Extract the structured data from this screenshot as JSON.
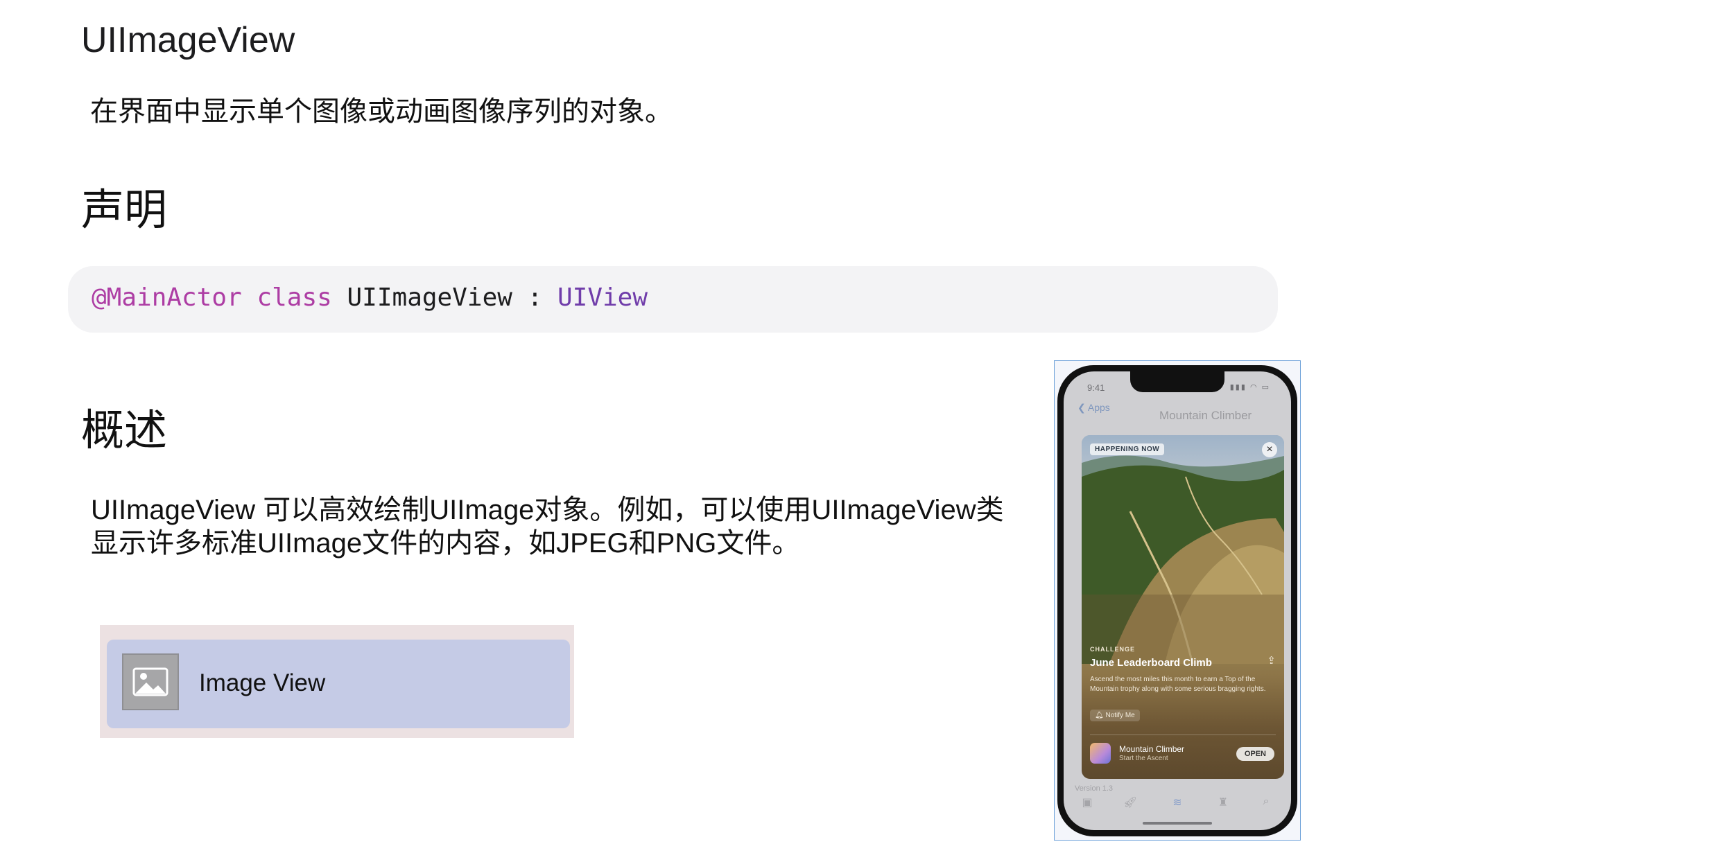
{
  "page": {
    "title": "UIImageView",
    "subtitle": "在界面中显示单个图像或动画图像序列的对象。",
    "declaration_heading": "声明",
    "code": {
      "attribute": "@MainActor",
      "keyword": "class",
      "name": "UIImageView",
      "separator": ":",
      "superclass": "UIView"
    },
    "overview_heading": "概述",
    "overview_text": "UIImageView 可以高效绘制UIImage对象。例如，可以使用UIImageView类显示许多标准UIImage文件的内容，如JPEG和PNG文件。"
  },
  "widget": {
    "label": "Image View",
    "icon": "photo-icon"
  },
  "phone": {
    "status_time": "9:41",
    "back_label": "Apps",
    "background_title": "Mountain Climber",
    "card": {
      "badge": "HAPPENING NOW",
      "close_icon": "close-icon",
      "category": "CHALLENGE",
      "title": "June Leaderboard Climb",
      "share_icon": "share-icon",
      "description": "Ascend the most miles this month to earn a Top of the Mountain trophy along with some serious bragging rights.",
      "notify_label": "Notify Me",
      "app_name": "Mountain Climber",
      "app_subtitle": "Start the Ascent",
      "open_label": "OPEN"
    },
    "version": "Version 1.3",
    "tabs": [
      "today-icon",
      "games-icon",
      "apps-icon",
      "arcade-icon",
      "search-icon"
    ]
  },
  "colors": {
    "code_keyword": "#ad3da4",
    "code_type": "#703daa",
    "code_background": "#f3f3f5",
    "widget_background": "#c5cbe6",
    "widget_outer": "#ece1e2",
    "phone_selection_border": "#6a9fd8"
  }
}
